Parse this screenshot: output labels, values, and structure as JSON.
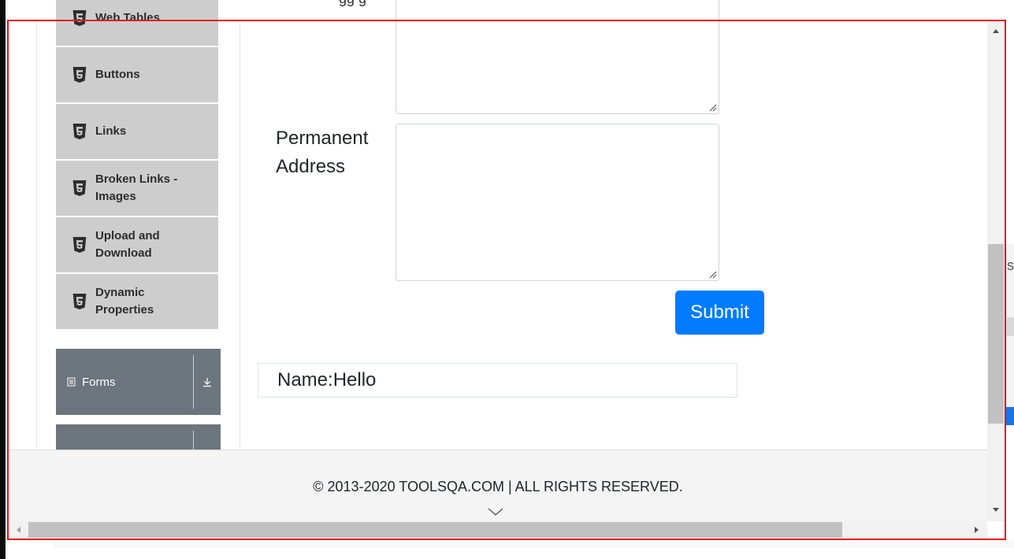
{
  "top": {
    "partial_text": "gg g",
    "partial_button_color": "#1a73e8"
  },
  "sidebar": {
    "items": [
      {
        "label": "Web Tables",
        "icon": "html5-shield-icon"
      },
      {
        "label": "Buttons",
        "icon": "html5-shield-icon"
      },
      {
        "label": "Links",
        "icon": "html5-shield-icon"
      },
      {
        "label": "Broken Links - Images",
        "icon": "html5-shield-icon"
      },
      {
        "label": "Upload and Download",
        "icon": "html5-shield-icon"
      },
      {
        "label": "Dynamic Properties",
        "icon": "html5-shield-icon"
      }
    ],
    "groups": [
      {
        "label": "Forms",
        "icon": "form-icon",
        "toggle_icon": "download-arrow-icon"
      },
      {
        "label": "",
        "icon": "",
        "toggle_icon": ""
      }
    ]
  },
  "form": {
    "permanent_address_label": "Permanent Address",
    "current_address_value": "",
    "permanent_address_value": "",
    "submit_label": "Submit",
    "output_name": "Name:Hello"
  },
  "footer": {
    "copyright": "© 2013-2020 TOOLSQA.COM | ALL RIGHTS RESERVED.",
    "scroll_icon": "chevron-down-icon"
  },
  "right_fragment_text": "sa",
  "colors": {
    "accent": "#007bff",
    "sidebar_item_bg": "#cdcdcd",
    "group_bg": "#6c757d",
    "frame_red": "#e0161b"
  }
}
